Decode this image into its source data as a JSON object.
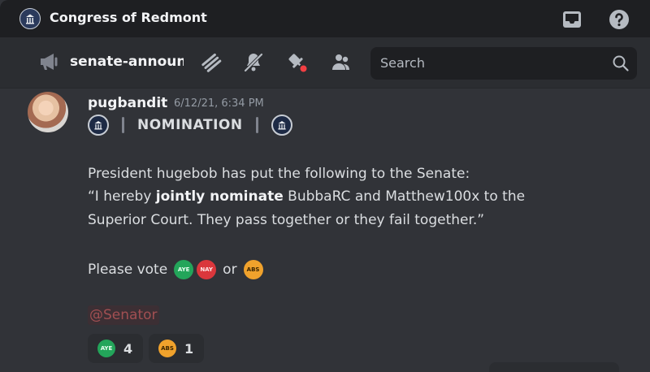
{
  "window": {
    "server_name": "Congress of Redmont"
  },
  "titlebar": {
    "inbox_icon": "inbox-icon",
    "help_icon": "help-icon"
  },
  "channel": {
    "name": "senate-announ",
    "icons": [
      "megaphone-icon",
      "threads-icon",
      "mute-icon",
      "pin-icon",
      "members-icon"
    ]
  },
  "search": {
    "placeholder": "Search"
  },
  "message": {
    "username": "pugbandit",
    "timestamp": "6/12/21, 6:34 PM",
    "nomination_title": "NOMINATION",
    "line1": "President hugebob has put the following to the Senate:",
    "line2_pre": "“I hereby ",
    "line2_bold": "jointly nominate",
    "line2_post": " BubbaRC and Matthew100x to the",
    "line3": "Superior Court. They pass together or they fail together.”",
    "vote_prefix": "Please vote",
    "vote_or": "or",
    "emoji_aye": "AYE",
    "emoji_nay": "NAY",
    "emoji_abs": "ABS",
    "mention": "@Senator"
  },
  "reactions": [
    {
      "emoji": "AYE",
      "count": "4"
    },
    {
      "emoji": "ABS",
      "count": "1"
    }
  ],
  "colors": {
    "aye": "#23a55a",
    "nay": "#da373c",
    "abs": "#f0a22c",
    "notification_dot": "#f23f43",
    "mention_text": "#a14f52"
  }
}
